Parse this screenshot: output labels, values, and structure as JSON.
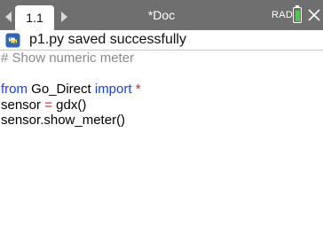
{
  "topbar": {
    "tab_label": "1.1",
    "doc_title": "*Doc",
    "mode": "RAD",
    "battery_level": 0.95,
    "colors": {
      "bar": "#6f6f6f",
      "battery": "#3fd13f"
    }
  },
  "status": {
    "icon": "python-icon",
    "message": "p1.py saved successfully"
  },
  "editor": {
    "lines": {
      "comment": "# Show numeric meter",
      "import_from": "from",
      "import_module": " Go_Direct ",
      "import_kw": "import",
      "import_star": " *",
      "assign_name": "sensor ",
      "assign_op": "=",
      "assign_call": " gdx()",
      "call_line": "sensor.show_meter()"
    },
    "colors": {
      "comment": "#8a8a8a",
      "keyword": "#1a3fd6",
      "operator": "#d22222"
    }
  }
}
